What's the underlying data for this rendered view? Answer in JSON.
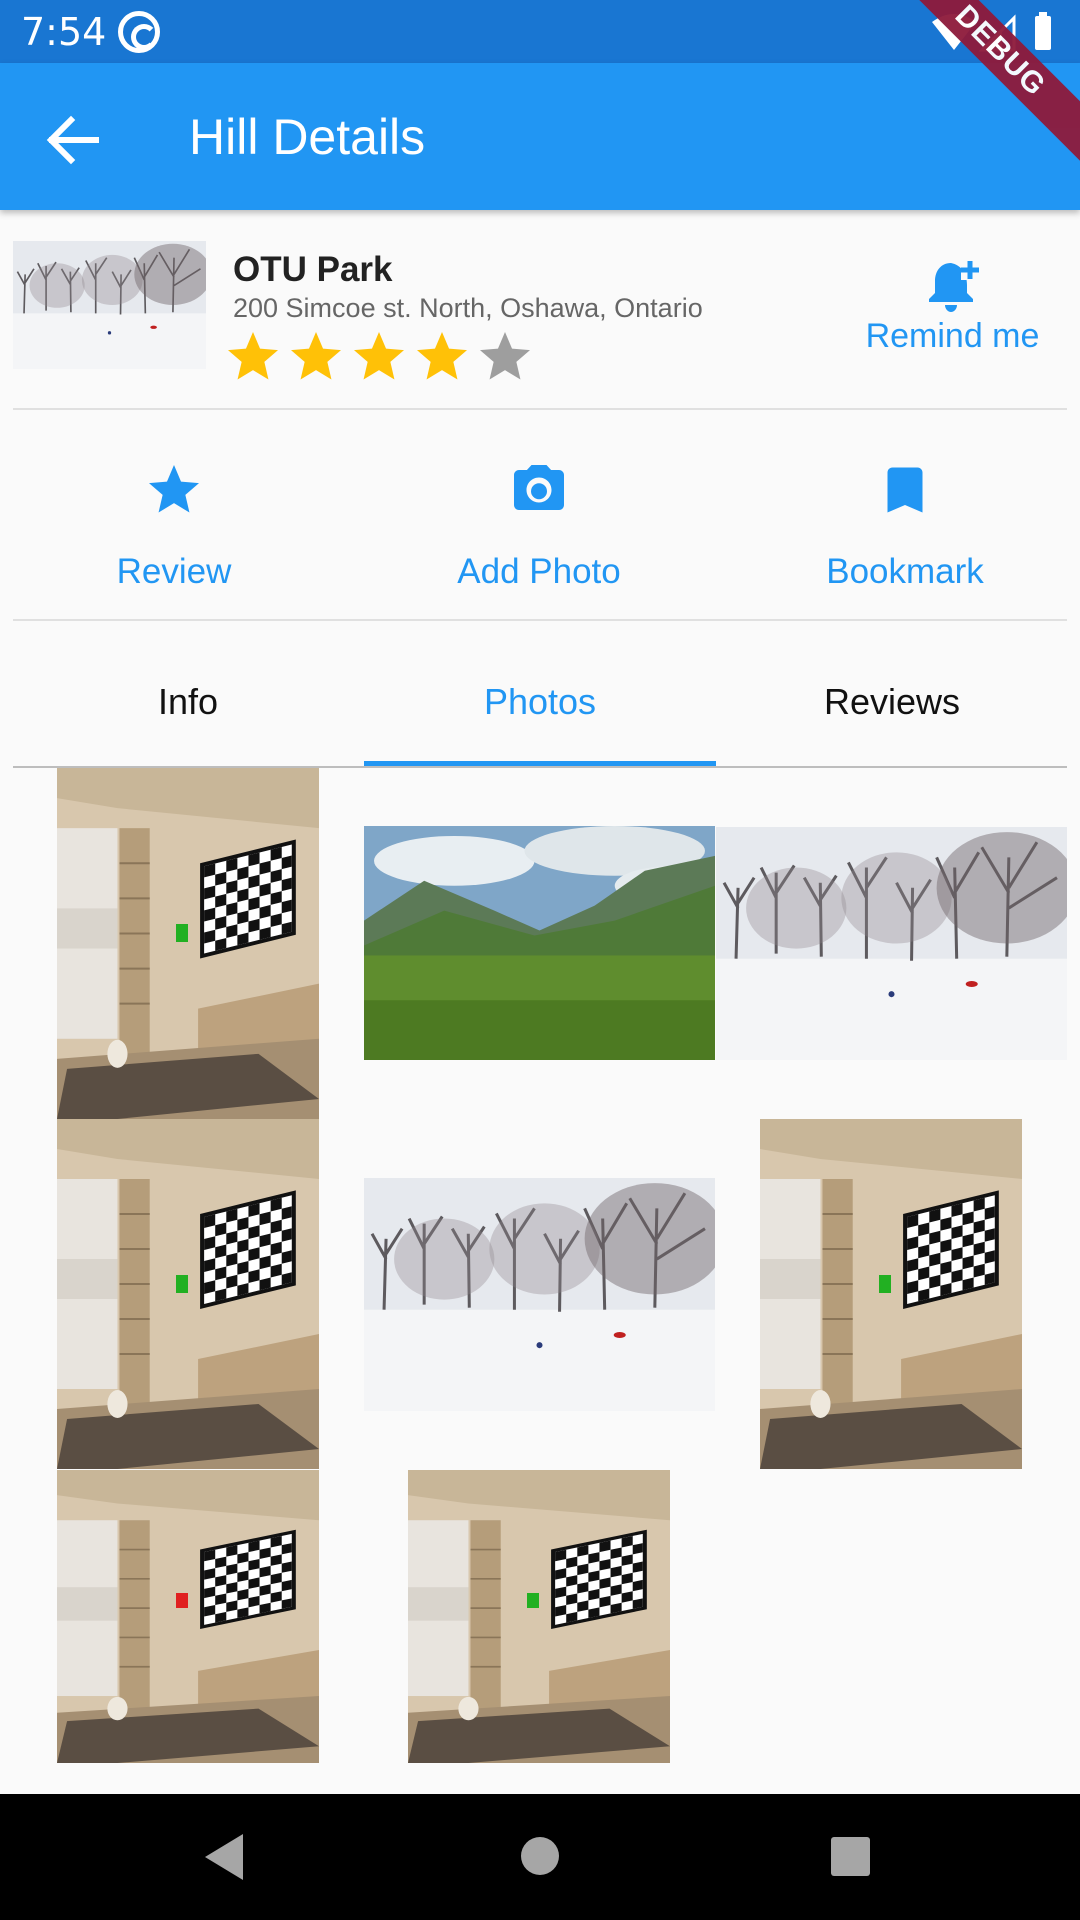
{
  "status_bar": {
    "time": "7:54"
  },
  "app_bar": {
    "title": "Hill Details",
    "debug_label": "DEBUG"
  },
  "hill": {
    "name": "OTU Park",
    "address": "200 Simcoe st. North, Oshawa, Ontario",
    "rating": 4,
    "rating_max": 5,
    "thumbnail": "snowy-park-thumbnail"
  },
  "remind": {
    "label": "Remind me",
    "icon": "bell-plus-icon"
  },
  "actions": [
    {
      "label": "Review",
      "icon": "star-icon"
    },
    {
      "label": "Add Photo",
      "icon": "camera-icon"
    },
    {
      "label": "Bookmark",
      "icon": "bookmark-icon"
    }
  ],
  "tabs": [
    {
      "label": "Info",
      "active": false
    },
    {
      "label": "Photos",
      "active": true
    },
    {
      "label": "Reviews",
      "active": false
    }
  ],
  "photos": [
    {
      "kind": "room-tv",
      "marker": "green"
    },
    {
      "kind": "mountain-valley"
    },
    {
      "kind": "snowy-park"
    },
    {
      "kind": "room-tv",
      "marker": "green"
    },
    {
      "kind": "snowy-park"
    },
    {
      "kind": "room-tv",
      "marker": "green"
    },
    {
      "kind": "room-tv",
      "marker": "red"
    },
    {
      "kind": "room-tv",
      "marker": "green"
    }
  ],
  "colors": {
    "primary": "#2196f3",
    "status_bar": "#1976d2",
    "star_filled": "#ffc107",
    "star_empty": "#9e9e9e",
    "marker_green": "#22b022",
    "marker_red": "#e02020"
  }
}
